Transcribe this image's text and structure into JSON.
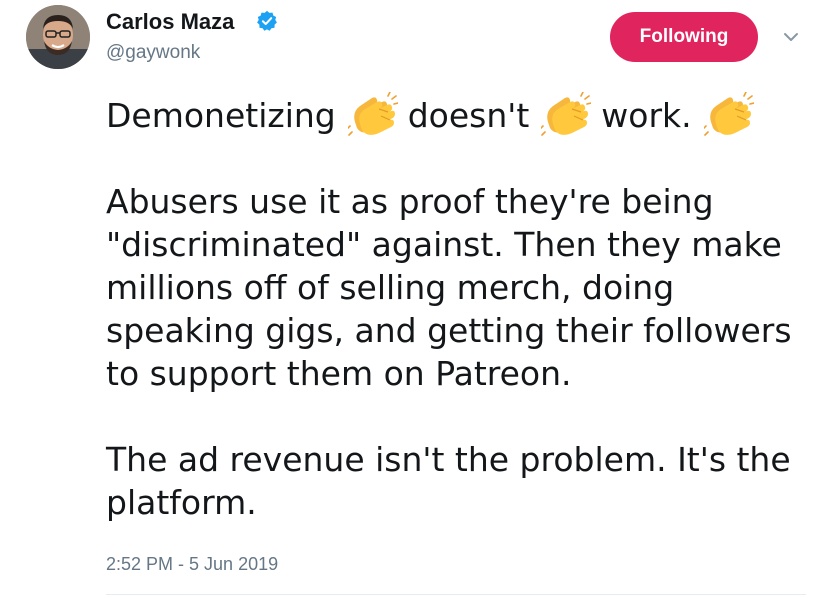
{
  "author": {
    "name": "Carlos Maza",
    "handle": "@gaywonk",
    "verified": true
  },
  "follow_button": {
    "label": "Following",
    "color": "#e0245e"
  },
  "menu_icon": "chevron-down-icon",
  "tweet": {
    "line1_words": [
      "Demonetizing",
      "doesn't",
      "work."
    ],
    "line1_emoji": "clapping-hands-icon",
    "paragraph2": "Abusers use it as proof they're being \"discriminated\" against. Then they make millions off of selling merch, doing speaking gigs, and getting their followers to support them on Patreon.",
    "paragraph3": "The ad revenue isn't the problem. It's the platform."
  },
  "timestamp": "2:52 PM - 5 Jun 2019",
  "colors": {
    "text": "#14171a",
    "secondary": "#657786",
    "verified": "#1da1f2",
    "emoji": "#ffc83d"
  }
}
